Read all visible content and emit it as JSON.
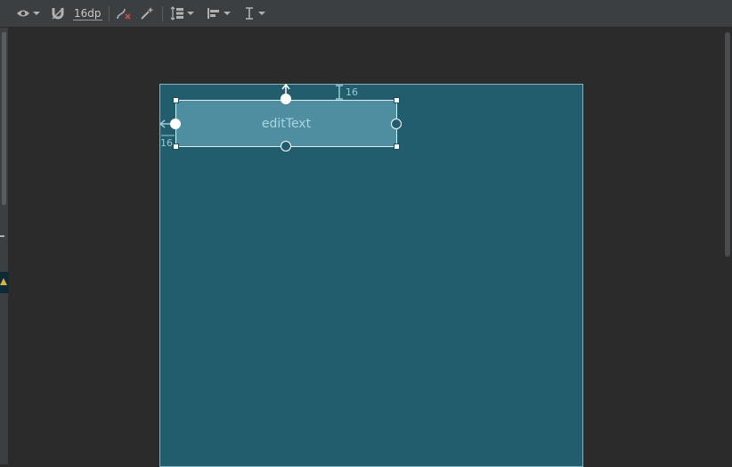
{
  "toolbar": {
    "view_options_icon": "eye-icon",
    "autoconnect_icon": "magnet-icon",
    "default_margin": "16dp",
    "clear_constraints_icon": "clear-constraints-icon",
    "infer_constraints_icon": "magic-wand-icon",
    "pack_icon": "pack-icon",
    "align_icon": "align-left-icon",
    "guidelines_icon": "guideline-icon"
  },
  "canvas": {
    "widget_label": "editText",
    "top_margin": "16",
    "left_margin": "16"
  },
  "colors": {
    "toolbar_bg": "#3c3f41",
    "canvas_bg": "#2b2b2b",
    "blueprint_bg": "#225d6d",
    "widget_bg": "#4f8ea0",
    "warning": "#e0b13a"
  }
}
